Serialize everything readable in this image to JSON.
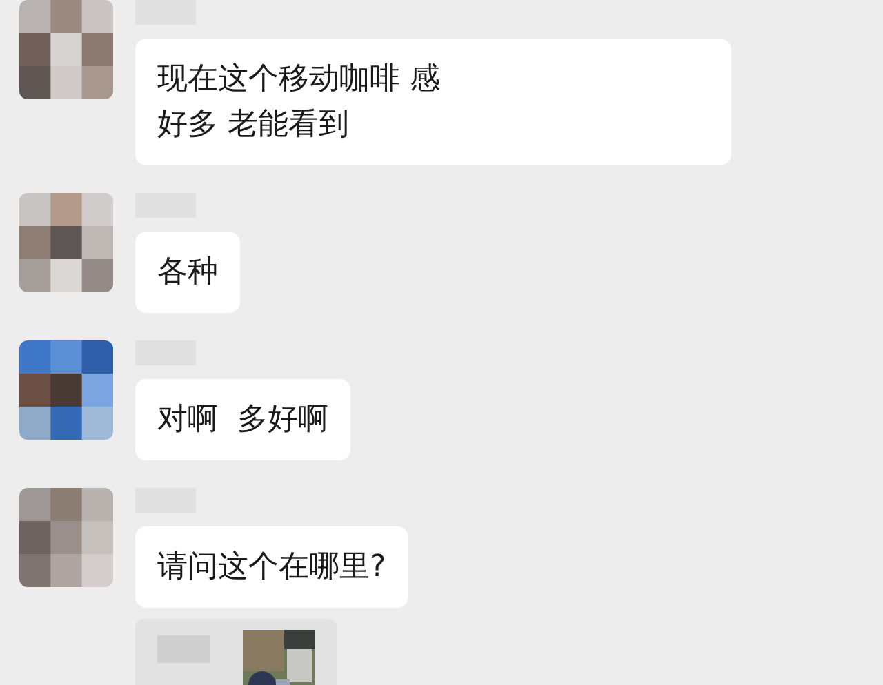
{
  "messages": [
    {
      "kind": "text",
      "lines": [
        "现在这个移动咖啡 感",
        "好多 老能看到"
      ]
    },
    {
      "kind": "text",
      "lines": [
        "各种"
      ]
    },
    {
      "kind": "text",
      "lines": [
        "对啊  多好啊"
      ]
    },
    {
      "kind": "text",
      "lines": [
        "请问这个在哪里?"
      ]
    },
    {
      "kind": "card"
    }
  ]
}
